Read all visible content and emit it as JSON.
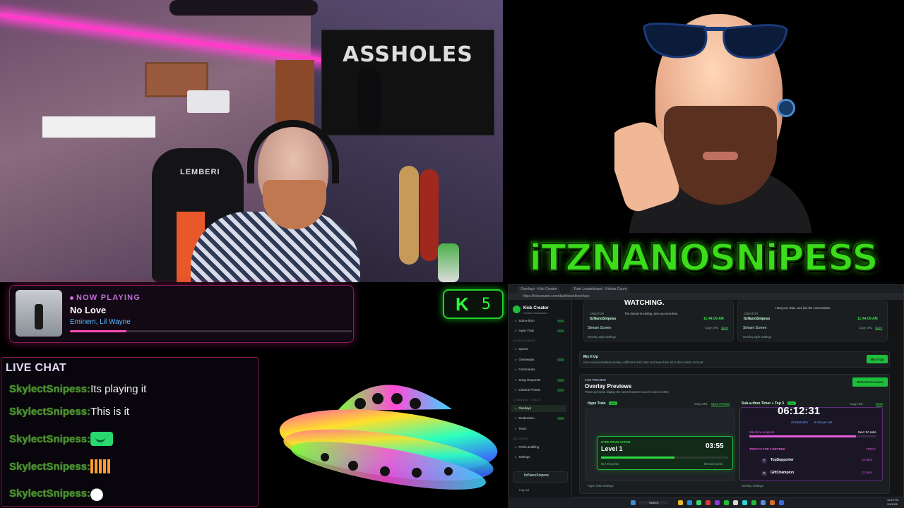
{
  "webcam": {
    "chair_brand": "LEMBERI",
    "banner_text": "ASSHOLES"
  },
  "overlay_name": "iTZNANOSNiPESS",
  "now_playing": {
    "label": "NOW PLAYING",
    "title": "No Love",
    "artist": "Eminem, Lil Wayne",
    "progress": 0.2
  },
  "kick": {
    "count": "5"
  },
  "chat": {
    "title": "LIVE CHAT",
    "messages": [
      {
        "user": "SkylectSnipess:",
        "text": "Its playing it"
      },
      {
        "user": "SkylectSnipess:",
        "text": "This is it"
      },
      {
        "user": "SkylectSnipess:",
        "emote": "green-face-emote"
      },
      {
        "user": "SkylectSnipess:",
        "emote": "bars-emote"
      },
      {
        "user": "SkylectSnipess:",
        "emote": "goose-emote"
      }
    ]
  },
  "browser": {
    "tabs": [
      "Overlays - Kick Creator",
      "Train Leaderboard - Kickstr Count"
    ],
    "url": "https://kickcreator.com/dashboard/overlays",
    "sidebar": {
      "app_name": "Kick Creator",
      "app_sub": "Creator Dashboard",
      "items_top": [
        "Sub-a-thon",
        "Hype Train"
      ],
      "engagement_head": "ENGAGEMENT",
      "engagement": [
        "Queue",
        "Giveaways",
        "Commands",
        "Song Requests",
        "Channel Points"
      ],
      "tools_head": "CHANNEL TOOLS",
      "tools": [
        "Overlays",
        "Moderation",
        "Team"
      ],
      "account_head": "ACCOUNT",
      "account": [
        "Perks & Billing",
        "Settings"
      ],
      "user": "ItzNanoSnipess",
      "logout": "Log out"
    },
    "top_cards": [
      {
        "heading": "WATCHING.",
        "desc": "The stream is ending. See you next time.",
        "creator_label": "CREATOR",
        "creator": "ItzNanoSnipess",
        "time": "11:44:09 AM",
        "name": "Stream Screen",
        "copy": "Copy URL",
        "open": "Open",
        "style": "Overlay style settings"
      },
      {
        "heading": "",
        "desc": "Hang out, relax, and join the conversation.",
        "creator_label": "CREATOR",
        "creator": "ItzNanoSnipess",
        "time": "11:44:09 AM",
        "name": "Stream Screen",
        "copy": "Copy URL",
        "open": "Open",
        "style": "Overlay style settings"
      }
    ],
    "mix": {
      "title": "Mix It Up",
      "desc": "Give every individual overlay a different vivid color and save them all to this creator account.",
      "button": "Mix It Up"
    },
    "preview": {
      "label": "LIVE PREVIEW",
      "title": "Overlay Previews",
      "desc": "These previews display the same browser sources used in OBS.",
      "refresh": "Refresh Previews",
      "hype": {
        "name": "Hype Train",
        "badge": "LIVE",
        "copy": "Copy URL",
        "open": "Open Preview",
        "active": "HYPE TRAIN ACTIVE",
        "level": "Level 1",
        "timer": "03:55",
        "points": "55 / 95 points",
        "total": "85 total points",
        "progress": 0.58,
        "settings": "Hype Train Settings"
      },
      "subathon": {
        "name": "Sub-a-thon Timer + Top 3",
        "badge": "LIVE",
        "copy": "Copy URL",
        "open": "Open",
        "timer": "06:12:31",
        "subs": "42 total subs",
        "mins": "5 min per sub",
        "milestone": "Milestone progress",
        "next": "Next: 50 subs",
        "progress": 0.84,
        "top_title": "TODAY'S TOP 3 GIFTERS",
        "top_when": "TODAY",
        "gifters": [
          {
            "rank": "T",
            "name": "TopSupporter",
            "subs": "15 subs"
          },
          {
            "rank": "G",
            "name": "GiftChampion",
            "subs": "12 subs"
          }
        ],
        "settings": "Overlay Settings"
      }
    },
    "taskbar": {
      "search": "Search",
      "time": "12:44 PM",
      "date": "3/1/2025"
    }
  },
  "colors": {
    "kick_green": "#2bff3a",
    "logo_green": "#3bdc1a",
    "chat_border": "#8a1a5a",
    "accent_pink": "#ff4ab8"
  }
}
